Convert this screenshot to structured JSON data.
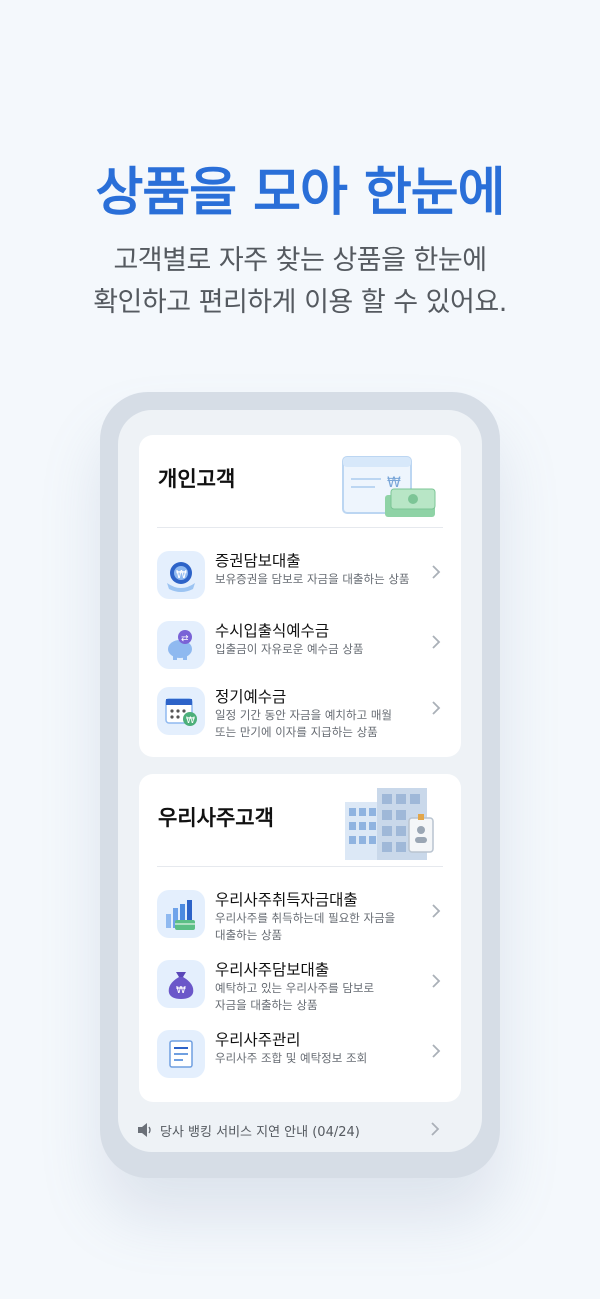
{
  "hero": {
    "title": "상품을 모아 한눈에",
    "subtitle_line1": "고객별로 자주 찾는 상품을 한눈에",
    "subtitle_line2": "확인하고 편리하게 이용 할 수 있어요."
  },
  "sections": [
    {
      "title": "개인고객",
      "illustration": "bankbook-cash-illustration",
      "items": [
        {
          "title": "증권담보대출",
          "desc": "보유증권을 담보로 자금을 대출하는 상품",
          "icon": "securities-globe-icon"
        },
        {
          "title": "수시입출식예수금",
          "desc": "입출금이 자유로운 예수금 상품",
          "icon": "piggy-bank-icon"
        },
        {
          "title": "정기예수금",
          "desc_line1": "일정 기간 동안 자금을 예치하고 매월",
          "desc_line2": "또는 만기에 이자를 지급하는 상품",
          "icon": "calendar-money-icon"
        }
      ]
    },
    {
      "title": "우리사주고객",
      "illustration": "office-building-illustration",
      "items": [
        {
          "title": "우리사주취득자금대출",
          "desc_line1": "우리사주를 취득하는데 필요한 자금을",
          "desc_line2": "대출하는 상품",
          "icon": "coin-stack-icon"
        },
        {
          "title": "우리사주담보대출",
          "desc_line1": "예탁하고 있는 우리사주를 담보로",
          "desc_line2": "자금을 대출하는 상품",
          "icon": "money-bag-icon"
        },
        {
          "title": "우리사주관리",
          "desc": "우리사주 조합 및 예탁정보 조회",
          "icon": "document-icon"
        }
      ]
    }
  ],
  "notice": {
    "text": "당사 뱅킹 서비스 지연 안내 (04/24)",
    "icon": "speaker-icon"
  },
  "colors": {
    "accent": "#2a6fd8",
    "background": "#f4f8fc",
    "icon_bg": "#e4effd"
  }
}
